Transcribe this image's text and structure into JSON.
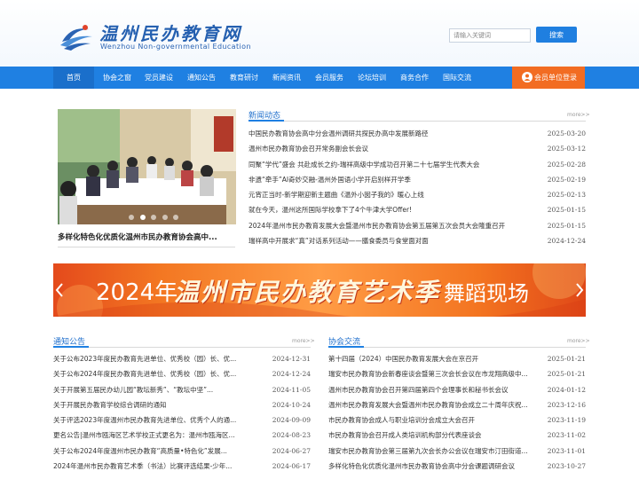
{
  "header": {
    "site_title": "温州民办教育网",
    "site_subtitle": "Wenzhou Non-governmental Education",
    "search_placeholder": "请输入关键词",
    "search_button": "搜索"
  },
  "nav": {
    "items": [
      "首页",
      "协会之窗",
      "党员建设",
      "通知公告",
      "教育研讨",
      "新闻资讯",
      "会员服务",
      "论坛培训",
      "商务合作",
      "国际交流"
    ],
    "member_login": "会员单位登录"
  },
  "feature": {
    "caption": "多样化特色化优质化温州市民办教育协会高中..."
  },
  "news": {
    "title": "新闻动态",
    "more": "more>>",
    "items": [
      {
        "title": "中国民办教育协会高中分会温州调研共探民办高中发展新路径",
        "date": "2025-03-20"
      },
      {
        "title": "温州市民办教育协会召开常务副会长会议",
        "date": "2025-03-12"
      },
      {
        "title": "同聚“学代”盛会 共赴成长之约-瑞祥高级中学成功召开第二十七届学生代表大会",
        "date": "2025-02-28"
      },
      {
        "title": "非遗“牵手”AI奇妙交融-温州外国语小学开启别样开学季",
        "date": "2025-02-19"
      },
      {
        "title": "元宵正当时-新学期迎新主题曲《温外小囡子我的》暖心上线",
        "date": "2025-02-13"
      },
      {
        "title": "就在今天，温州这所国际学校拿下了4个牛津大学Offer!",
        "date": "2025-01-15"
      },
      {
        "title": "2024年温州市民办教育发展大会暨温州市民办教育协会第五届第五次会员大会隆重召开",
        "date": "2025-01-15"
      },
      {
        "title": "瑞祥高中开展求“真”对话系列活动——膳食委员与食堂面对面",
        "date": "2024-12-24"
      }
    ]
  },
  "banner": {
    "year": "2024年",
    "title": "温州市民办教育艺术季",
    "subtitle": "舞蹈现场"
  },
  "notices": {
    "title": "通知公告",
    "more": "more>>",
    "items": [
      {
        "title": "关于公布2023年度民办教育先进单位、优秀校（园）长、优...",
        "date": "2024-12-31"
      },
      {
        "title": "关于公布2024年度民办教育先进单位、优秀校（园）长、优...",
        "date": "2024-12-24"
      },
      {
        "title": "关于开展第五届民办幼儿园“教坛新秀”、“教坛中坚”...",
        "date": "2024-11-05"
      },
      {
        "title": "关于开展民办教育学校综合调研的通知",
        "date": "2024-10-24"
      },
      {
        "title": "关于评选2023年度温州市民办教育先进单位、优秀个人的通...",
        "date": "2024-09-09"
      },
      {
        "title": "更名公告|温州市瓯海区艺术学校正式更名为：温州市瓯海区...",
        "date": "2024-08-23"
      },
      {
        "title": "关于公布2024年度温州市民办教育“高质量•特色化”发展...",
        "date": "2024-06-27"
      },
      {
        "title": "2024年温州市民办教育艺术季（书法）比赛评选结果-少年...",
        "date": "2024-06-17"
      }
    ]
  },
  "exchange": {
    "title": "协会交流",
    "more": "more>>",
    "items": [
      {
        "title": "第十四届（2024）中国民办教育发展大会在京召开",
        "date": "2025-01-21"
      },
      {
        "title": "瑞安市民办教育协会新春座谈会暨第三次会长会议在市龙翔高级中...",
        "date": "2025-01-21"
      },
      {
        "title": "温州市民办教育协会召开第四届第四个会理事长和秘书长会议",
        "date": "2024-01-12"
      },
      {
        "title": "温州市民办教育发展大会暨温州市民办教育协会成立二十周年庆祝...",
        "date": "2023-12-16"
      },
      {
        "title": "市民办教育协会成人与职业培训分会成立大会召开",
        "date": "2023-11-19"
      },
      {
        "title": "市民办教育协会召开成人类培训机构部分代表座谈会",
        "date": "2023-11-02"
      },
      {
        "title": "瑞安市民办教育协会第三届第九次会长办公会议在瑞安市汀田街道...",
        "date": "2023-11-01"
      },
      {
        "title": "多样化特色化优质化温州市民办教育协会高中分会课题调研会议",
        "date": "2023-10-27"
      }
    ]
  }
}
